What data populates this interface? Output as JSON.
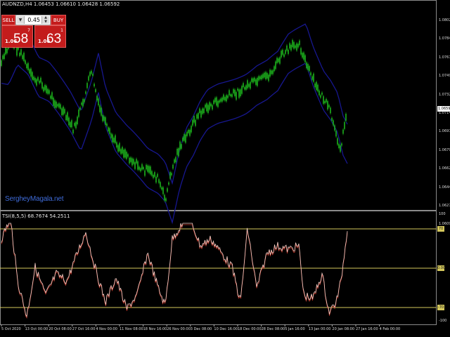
{
  "symbol_title": "AUDNZD,H4  1.06453 1.06610 1.06428 1.06592",
  "oscillator_title": "TSI(8,5,5) 68.7674 54.2511",
  "watermark": "SergheyMagala.net",
  "trade_panel": {
    "sell_label": "SELL",
    "buy_label": "BUY",
    "lot_value": "0.45",
    "sell_price": {
      "prefix": "1.06",
      "big": "58",
      "sup": "7"
    },
    "buy_price": {
      "prefix": "1.06",
      "big": "63",
      "sup": "1"
    }
  },
  "price_axis": [
    "1.08020",
    "1.07845",
    "1.07670",
    "1.07495",
    "1.07320",
    "1.07145",
    "1.06970",
    "1.06795",
    "1.06620",
    "1.06445",
    "1.06270",
    "1.06090"
  ],
  "current_price": "1.06592",
  "osc_levels": {
    "upper": "70",
    "middle": "0.00",
    "lower": "-70"
  },
  "osc_axis": {
    "top": "100",
    "bottom": "-100"
  },
  "time_axis": [
    "5 Oct 2020",
    "13 Oct 00:00",
    "20 Oct 08:00",
    "27 Oct 16:00",
    "4 Nov 00:00",
    "11 Nov 08:00",
    "18 Nov 16:00",
    "26 Nov 00:00",
    "3 Dec 08:00",
    "10 Dec 16:00",
    "18 Dec 00:00",
    "28 Dec 08:00",
    "5 Jan 16:00",
    "13 Jan 00:00",
    "20 Jan 08:00",
    "27 Jan 16:00",
    "4 Feb 00:00"
  ],
  "colors": {
    "candles": "#1db31d",
    "envelope": "#17178f",
    "osc_line": "#ff8c7a",
    "levels": "#d4c85c",
    "panel": "#c31c1c"
  }
}
